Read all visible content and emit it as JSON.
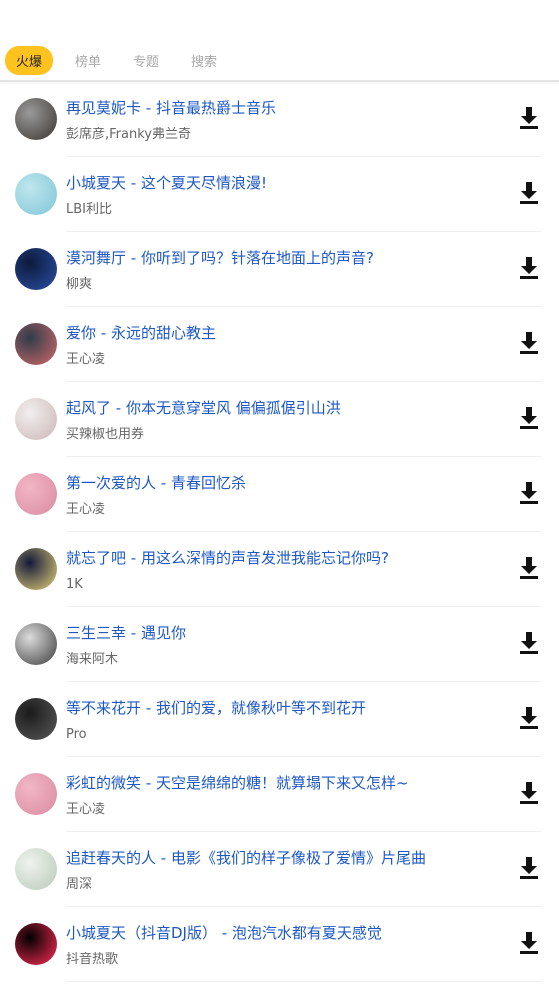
{
  "tabs": [
    {
      "label": "火爆",
      "active": true
    },
    {
      "label": "榜单",
      "active": false
    },
    {
      "label": "专题",
      "active": false
    },
    {
      "label": "搜索",
      "active": false
    }
  ],
  "songs": [
    {
      "title": "再见莫妮卡 - 抖音最热爵士音乐",
      "artist": "彭席彦,Franky弗兰奇",
      "cover": [
        "#9a9a9a",
        "#3a3530"
      ]
    },
    {
      "title": "小城夏天 - 这个夏天尽情浪漫!",
      "artist": "LBI利比",
      "cover": [
        "#bfe6ee",
        "#7fc6d6"
      ]
    },
    {
      "title": "漠河舞厅 - 你听到了吗？针落在地面上的声音?",
      "artist": "柳爽",
      "cover": [
        "#0d1a3a",
        "#2b4fa8"
      ]
    },
    {
      "title": "爱你 - 永远的甜心教主",
      "artist": "王心凌",
      "cover": [
        "#2e3b4a",
        "#d26a6a"
      ]
    },
    {
      "title": "起风了 - 你本无意穿堂风 偏偏孤倨引山洪",
      "artist": "买辣椒也用券",
      "cover": [
        "#f3eeee",
        "#c9b6b6"
      ]
    },
    {
      "title": "第一次爱的人 - 青春回忆杀",
      "artist": "王心凌",
      "cover": [
        "#f2b6c6",
        "#d98ba1"
      ]
    },
    {
      "title": "就忘了吧 - 用这么深情的声音发泄我能忘记你吗?",
      "artist": "1K",
      "cover": [
        "#141a3a",
        "#e6d27a"
      ]
    },
    {
      "title": "三生三幸 - 遇见你",
      "artist": "海来阿木",
      "cover": [
        "#dcdcdc",
        "#3b3b3b"
      ]
    },
    {
      "title": "等不来花开 - 我们的爱，就像秋叶等不到花开",
      "artist": "Pro",
      "cover": [
        "#1b1b1b",
        "#5a5a5a"
      ]
    },
    {
      "title": "彩虹的微笑 - 天空是绵绵的糖！就算塌下来又怎样~",
      "artist": "王心凌",
      "cover": [
        "#f2b6c6",
        "#d98ba1"
      ]
    },
    {
      "title": "追赶春天的人 - 电影《我们的样子像极了爱情》片尾曲",
      "artist": "周深",
      "cover": [
        "#eef3ee",
        "#b9c9b8"
      ]
    },
    {
      "title": "小城夏天（抖音DJ版） - 泡泡汽水都有夏天感觉",
      "artist": "抖音热歌",
      "cover": [
        "#000000",
        "#ff2c55"
      ]
    }
  ],
  "icons": {
    "download": "download-icon"
  },
  "colors": {
    "accent": "#ffc21e",
    "title": "#1e58c4",
    "artist": "#666666"
  }
}
